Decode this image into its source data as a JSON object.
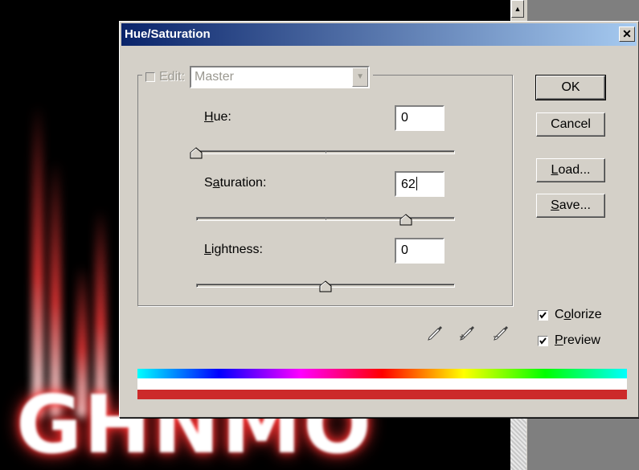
{
  "background": {
    "art_text": "GHNMO",
    "glow_color": "#ff3030",
    "scroll_up_glyph": "▲"
  },
  "dialog": {
    "title": "Hue/Saturation",
    "close_glyph": "✕",
    "edit": {
      "label": "Edit:",
      "select_value": "Master",
      "arrow_glyph": "▼"
    },
    "fields": {
      "hue": {
        "label_mnemonic": "H",
        "label_rest": "ue:",
        "value": "0",
        "level": 0.0
      },
      "saturation": {
        "label_pre": "S",
        "label_mnemonic": "a",
        "label_rest": "turation:",
        "value": "62",
        "level": 0.81
      },
      "lightness": {
        "label_pre": "",
        "label_mnemonic": "L",
        "label_rest": "ightness:",
        "value": "0",
        "level": 0.5
      }
    },
    "buttons": {
      "ok": "OK",
      "cancel": "Cancel",
      "load_mnemonic": "L",
      "load_rest": "oad...",
      "save_mnemonic": "S",
      "save_rest": "ave..."
    },
    "checkboxes": {
      "colorize": {
        "pre": "C",
        "mnemonic": "o",
        "rest": "lorize",
        "checked": true
      },
      "preview": {
        "pre": "",
        "mnemonic": "P",
        "rest": "review",
        "checked": true
      }
    },
    "eyedroppers": [
      "eyedropper-icon",
      "eyedropper-plus-icon",
      "eyedropper-minus-icon"
    ],
    "colors": {
      "titlebar_start": "#0a246a",
      "titlebar_end": "#a6caf0",
      "face": "#d4d0c8",
      "result_bar": "#cc2a2a"
    }
  }
}
